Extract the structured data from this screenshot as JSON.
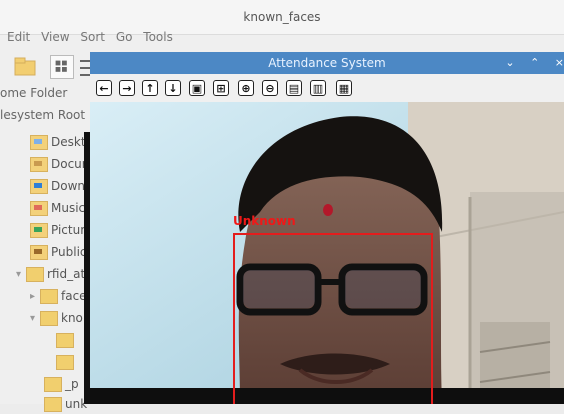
{
  "file_manager": {
    "window_title": "known_faces",
    "menu": [
      "Edit",
      "View",
      "Sort",
      "Go",
      "Tools"
    ],
    "places": [
      "ome Folder",
      "lesystem Root"
    ],
    "tree": [
      {
        "label": "Deskt"
      },
      {
        "label": "Docur"
      },
      {
        "label": "Down"
      },
      {
        "label": "Music"
      },
      {
        "label": "Pictur"
      },
      {
        "label": "Public"
      },
      {
        "label": "rfid_at"
      },
      {
        "label": "face"
      },
      {
        "label": "kno"
      },
      {
        "label": ""
      },
      {
        "label": ""
      },
      {
        "label": "_p"
      },
      {
        "label": "unk"
      }
    ]
  },
  "app": {
    "title": "Attendance System",
    "detection_label": "Unknown",
    "toolbar_icons": [
      "back-arrow",
      "forward-arrow",
      "up-arrow",
      "down-arrow",
      "image",
      "image-edit",
      "zoom-in",
      "zoom-out",
      "save-to",
      "clipboard",
      "save"
    ],
    "controls": [
      "⌄",
      "⌃",
      "×"
    ]
  }
}
